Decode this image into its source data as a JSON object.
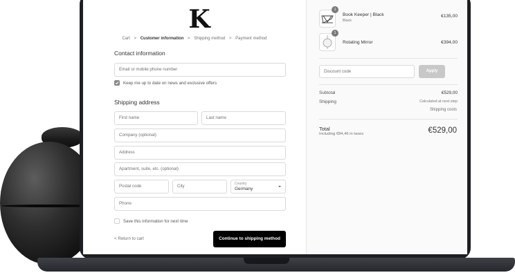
{
  "brand": {
    "logo_letter": "K"
  },
  "breadcrumb": {
    "items": [
      "Cart",
      "Customer information",
      "Shipping method",
      "Payment method"
    ],
    "separator": ">",
    "active_index": 1
  },
  "contact": {
    "title": "Contact information",
    "email_placeholder": "Email or mobile phone number",
    "newsletter_label": "Keep me up to date on news and exclusive offers",
    "newsletter_checked": true
  },
  "shipping": {
    "title": "Shipping address",
    "first_name_placeholder": "First name",
    "last_name_placeholder": "Last name",
    "company_placeholder": "Company (optional)",
    "address_placeholder": "Address",
    "apartment_placeholder": "Apartment, suite, etc. (optional)",
    "postal_placeholder": "Postal code",
    "city_placeholder": "City",
    "country_label": "Country",
    "country_value": "Germany",
    "phone_placeholder": "Phone",
    "save_info_label": "Save this information for next time",
    "save_info_checked": false
  },
  "actions": {
    "return_label": "< Return to cart",
    "continue_label": "Continue to shipping method"
  },
  "order": {
    "items": [
      {
        "name": "Book Keeper | Black",
        "variant": "Black",
        "price": "€135,00",
        "quantity": "1",
        "thumb_icon": "book-keeper-icon"
      },
      {
        "name": "Rotating Mirror",
        "variant": "",
        "price": "€394,00",
        "quantity": "1",
        "thumb_icon": "mirror-icon"
      }
    ],
    "discount_placeholder": "Discount code",
    "apply_label": "Apply",
    "subtotal_label": "Subtotal",
    "subtotal_value": "€529,00",
    "shipping_label": "Shipping",
    "shipping_value": "Calculated at next step",
    "shipping_costs_link": "Shipping costs",
    "total_label": "Total",
    "taxes_note": "Including €84,46 in taxes",
    "total_value": "€529,00"
  },
  "colors": {
    "button_primary": "#000000",
    "apply_disabled": "#c8c8c8",
    "summary_bg": "#fafafa",
    "checkbox_checked": "#8a8a8a"
  }
}
